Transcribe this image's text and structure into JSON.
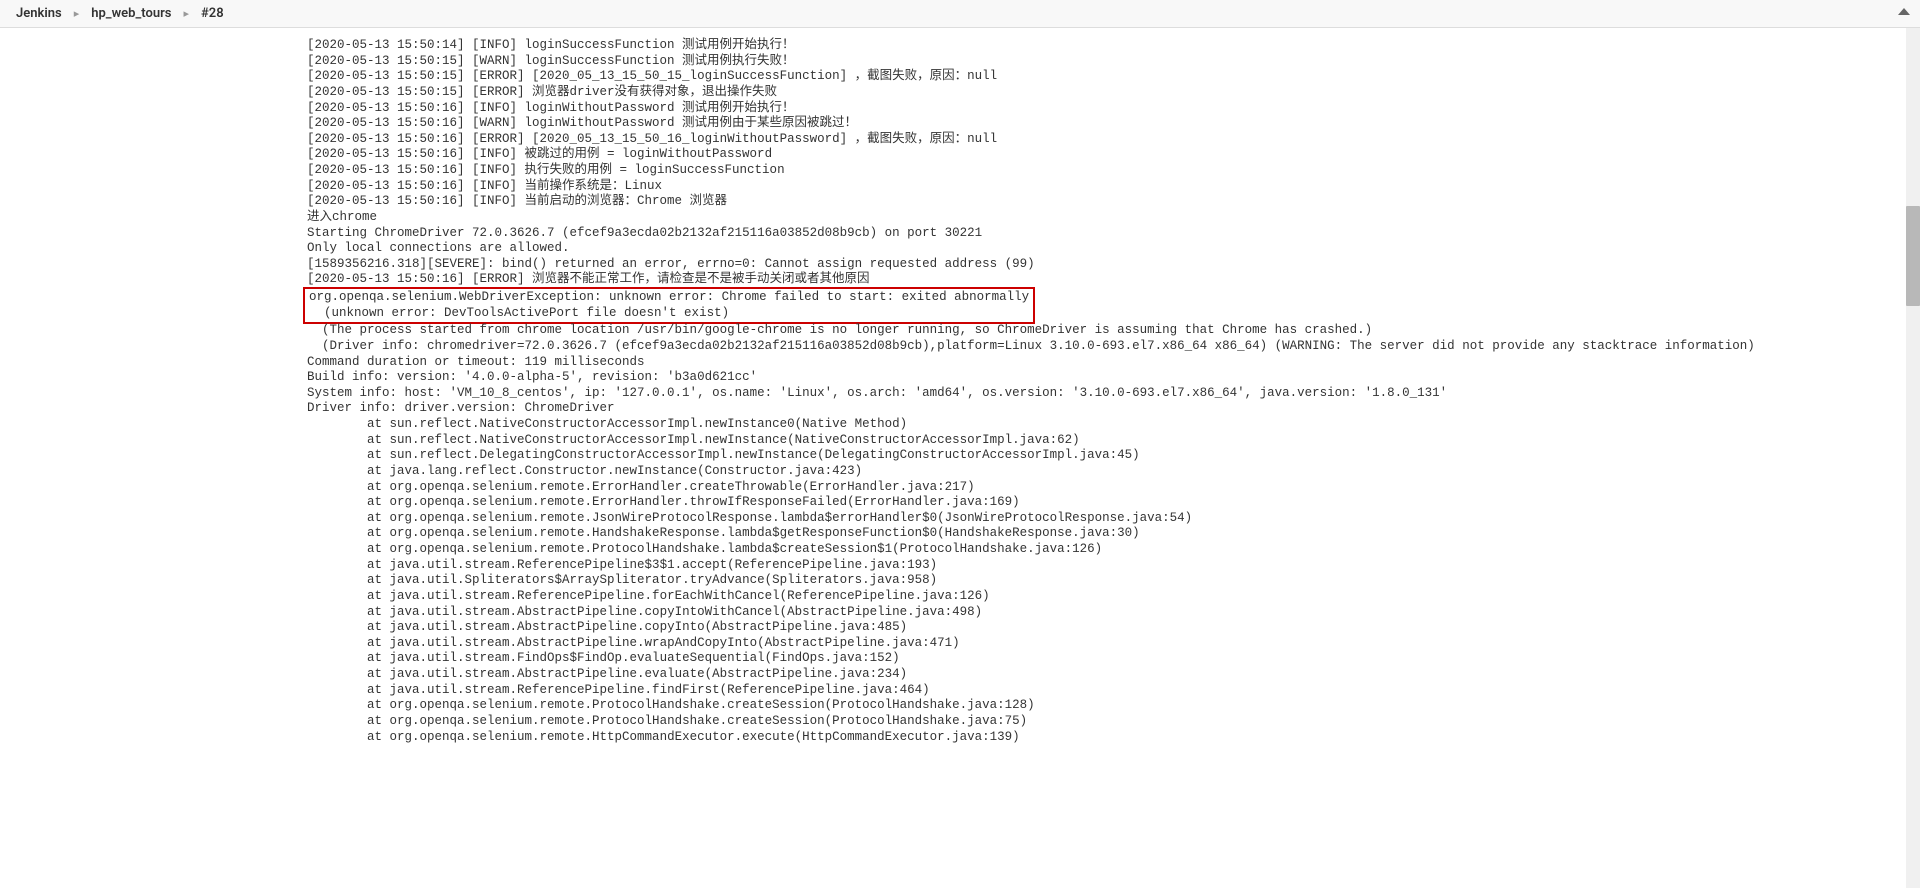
{
  "breadcrumb": {
    "root": "Jenkins",
    "project": "hp_web_tours",
    "build": "#28"
  },
  "console": {
    "lines_before": [
      "[2020-05-13 15:50:14] [INFO] loginSuccessFunction 测试用例开始执行！",
      "[2020-05-13 15:50:15] [WARN] loginSuccessFunction 测试用例执行失败！",
      "[2020-05-13 15:50:15] [ERROR] [2020_05_13_15_50_15_loginSuccessFunction] ，截图失败，原因：null",
      "[2020-05-13 15:50:15] [ERROR] 浏览器driver没有获得对象，退出操作失败",
      "[2020-05-13 15:50:16] [INFO] loginWithoutPassword 测试用例开始执行！",
      "[2020-05-13 15:50:16] [WARN] loginWithoutPassword 测试用例由于某些原因被跳过！",
      "[2020-05-13 15:50:16] [ERROR] [2020_05_13_15_50_16_loginWithoutPassword] ，截图失败，原因：null",
      "[2020-05-13 15:50:16] [INFO] 被跳过的用例 = loginWithoutPassword",
      "[2020-05-13 15:50:16] [INFO] 执行失败的用例 = loginSuccessFunction",
      "[2020-05-13 15:50:16] [INFO] 当前操作系统是：Linux",
      "[2020-05-13 15:50:16] [INFO] 当前启动的浏览器：Chrome 浏览器",
      "进入chrome",
      "Starting ChromeDriver 72.0.3626.7 (efcef9a3ecda02b2132af215116a03852d08b9cb) on port 30221",
      "Only local connections are allowed.",
      "[1589356216.318][SEVERE]: bind() returned an error, errno=0: Cannot assign requested address (99)",
      "[2020-05-13 15:50:16] [ERROR] 浏览器不能正常工作，请检查是不是被手动关闭或者其他原因"
    ],
    "highlighted_lines": [
      "org.openqa.selenium.WebDriverException: unknown error: Chrome failed to start: exited abnormally",
      "  (unknown error: DevToolsActivePort file doesn't exist)"
    ],
    "lines_after": [
      "  (The process started from chrome location /usr/bin/google-chrome is no longer running, so ChromeDriver is assuming that Chrome has crashed.)",
      "  (Driver info: chromedriver=72.0.3626.7 (efcef9a3ecda02b2132af215116a03852d08b9cb),platform=Linux 3.10.0-693.el7.x86_64 x86_64) (WARNING: The server did not provide any stacktrace information)",
      "Command duration or timeout: 119 milliseconds",
      "Build info: version: '4.0.0-alpha-5', revision: 'b3a0d621cc'",
      "System info: host: 'VM_10_8_centos', ip: '127.0.0.1', os.name: 'Linux', os.arch: 'amd64', os.version: '3.10.0-693.el7.x86_64', java.version: '1.8.0_131'",
      "Driver info: driver.version: ChromeDriver",
      "\tat sun.reflect.NativeConstructorAccessorImpl.newInstance0(Native Method)",
      "\tat sun.reflect.NativeConstructorAccessorImpl.newInstance(NativeConstructorAccessorImpl.java:62)",
      "\tat sun.reflect.DelegatingConstructorAccessorImpl.newInstance(DelegatingConstructorAccessorImpl.java:45)",
      "\tat java.lang.reflect.Constructor.newInstance(Constructor.java:423)",
      "\tat org.openqa.selenium.remote.ErrorHandler.createThrowable(ErrorHandler.java:217)",
      "\tat org.openqa.selenium.remote.ErrorHandler.throwIfResponseFailed(ErrorHandler.java:169)",
      "\tat org.openqa.selenium.remote.JsonWireProtocolResponse.lambda$errorHandler$0(JsonWireProtocolResponse.java:54)",
      "\tat org.openqa.selenium.remote.HandshakeResponse.lambda$getResponseFunction$0(HandshakeResponse.java:30)",
      "\tat org.openqa.selenium.remote.ProtocolHandshake.lambda$createSession$1(ProtocolHandshake.java:126)",
      "\tat java.util.stream.ReferencePipeline$3$1.accept(ReferencePipeline.java:193)",
      "\tat java.util.Spliterators$ArraySpliterator.tryAdvance(Spliterators.java:958)",
      "\tat java.util.stream.ReferencePipeline.forEachWithCancel(ReferencePipeline.java:126)",
      "\tat java.util.stream.AbstractPipeline.copyIntoWithCancel(AbstractPipeline.java:498)",
      "\tat java.util.stream.AbstractPipeline.copyInto(AbstractPipeline.java:485)",
      "\tat java.util.stream.AbstractPipeline.wrapAndCopyInto(AbstractPipeline.java:471)",
      "\tat java.util.stream.FindOps$FindOp.evaluateSequential(FindOps.java:152)",
      "\tat java.util.stream.AbstractPipeline.evaluate(AbstractPipeline.java:234)",
      "\tat java.util.stream.ReferencePipeline.findFirst(ReferencePipeline.java:464)",
      "\tat org.openqa.selenium.remote.ProtocolHandshake.createSession(ProtocolHandshake.java:128)",
      "\tat org.openqa.selenium.remote.ProtocolHandshake.createSession(ProtocolHandshake.java:75)",
      "\tat org.openqa.selenium.remote.HttpCommandExecutor.execute(HttpCommandExecutor.java:139)"
    ]
  }
}
